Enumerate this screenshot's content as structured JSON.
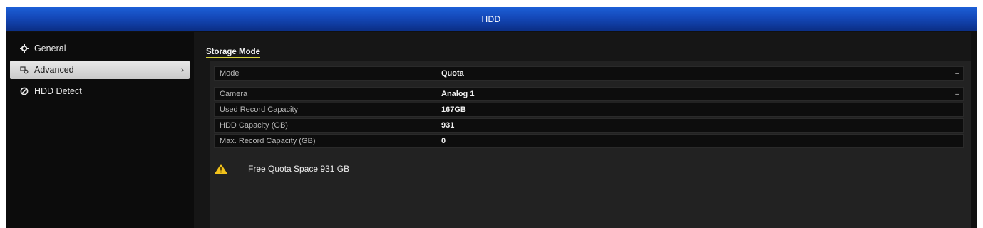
{
  "window": {
    "title": "HDD"
  },
  "sidebar": {
    "items": [
      {
        "label": "General",
        "icon": "gear-icon",
        "active": false
      },
      {
        "label": "Advanced",
        "icon": "advanced-icon",
        "active": true
      },
      {
        "label": "HDD Detect",
        "icon": "detect-icon",
        "active": false
      }
    ]
  },
  "section": {
    "title": "Storage Mode"
  },
  "fields": {
    "mode": {
      "label": "Mode",
      "value": "Quota"
    },
    "camera": {
      "label": "Camera",
      "value": "Analog 1"
    },
    "used_record_capacity": {
      "label": "Used Record Capacity",
      "value": "167GB"
    },
    "hdd_capacity": {
      "label": "HDD Capacity (GB)",
      "value": "931"
    },
    "max_record_capacity": {
      "label": "Max. Record Capacity (GB)",
      "value": "0"
    }
  },
  "notice": {
    "text": "Free Quota Space 931 GB",
    "icon": "warning-icon"
  },
  "colors": {
    "titlebar": "#1448b8",
    "accent_underline": "#d7d23a",
    "warning": "#f2c21b"
  }
}
